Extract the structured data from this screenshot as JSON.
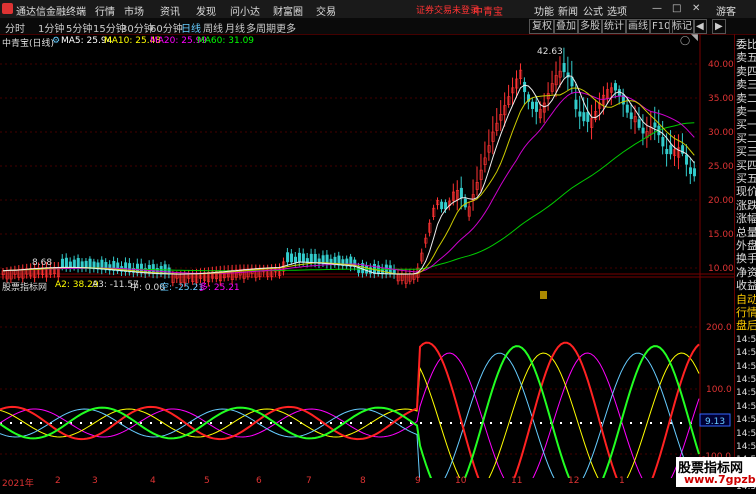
{
  "app_title": "通达信金融终端",
  "menu": [
    "行情",
    "市场",
    "资讯",
    "发现",
    "问小达",
    "财富圈",
    "交易"
  ],
  "warning": "证券交易未登录",
  "stock_title": "中青宝",
  "right_menu": [
    "功能",
    "新闻",
    "公式",
    "选项"
  ],
  "guest": "游客",
  "periods": [
    "分时",
    "1分钟",
    "5分钟",
    "15分钟",
    "30分钟",
    "60分钟",
    "日线",
    "周线",
    "月线",
    "多周期",
    "更多"
  ],
  "active_period": "日线",
  "toolbar": [
    "复权",
    "叠加",
    "多股",
    "统计",
    "画线",
    "F10",
    "标记",
    "◀",
    "▶"
  ],
  "chart_title": "中青宝(日线)",
  "ma": {
    "ma5": "MA5: 25.94",
    "ma10": "MA10: 25.48",
    "ma20": "MA20: 25.99",
    "ma60": "MA60: 31.09"
  },
  "ma_colors": {
    "ma5": "#ffffff",
    "ma10": "#ffff00",
    "ma20": "#ff00ff",
    "ma60": "#00ff00"
  },
  "price_axis": [
    "40.00",
    "35.00",
    "30.00",
    "25.00",
    "20.00",
    "15.00",
    "10.00"
  ],
  "high_label": "42.63",
  "low_label": "8.68",
  "sub_indicator": {
    "name": "股票指标网",
    "a2": "A2: 38.29",
    "a3": "A3: -11.57",
    "zhong": "中: 0.00",
    "kong": "空: -25.21",
    "duo": "多: 25.21"
  },
  "sub_axis": [
    "200.0",
    "100.0",
    "0.00",
    "-100.0"
  ],
  "sub_value": "9.13",
  "right_panel": [
    "委比",
    "卖五",
    "卖四",
    "卖三",
    "卖二",
    "卖一",
    "买一",
    "买二",
    "买三",
    "买四",
    "买五",
    "现价",
    "涨跌",
    "涨幅",
    "总量",
    "外盘",
    "换手",
    "净资",
    "收益",
    "自动",
    "行情",
    "盘后",
    "14:50",
    "14:50",
    "14:50",
    "14:50",
    "14:50",
    "14:50",
    "14:50",
    "14:50",
    "14:50",
    "14:50",
    "14:50",
    "14:50"
  ],
  "dates": [
    "2021年",
    "2",
    "3",
    "4",
    "5",
    "6",
    "7",
    "8",
    "9",
    "10",
    "11",
    "12",
    "1"
  ],
  "watermark": {
    "line1": "股票指标网",
    "line2": "www.7gpzb.com"
  }
}
